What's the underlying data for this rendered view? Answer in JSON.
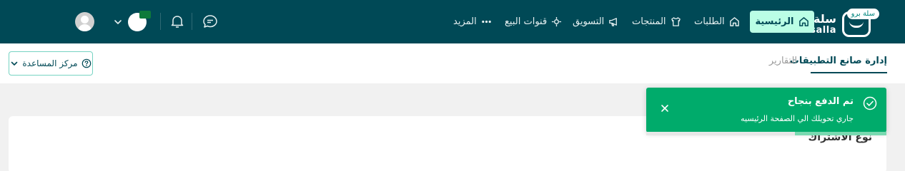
{
  "brand": {
    "name_ar": "سلة",
    "name_en": "salla",
    "badge": "سلة برو"
  },
  "nav": {
    "home": "الرئيسية",
    "orders": "الطلبات",
    "products": "المنتجات",
    "marketing": "التسويق",
    "channels": "قنوات البيع",
    "more": "المزيد"
  },
  "tabs": {
    "active": "إدارة صانع التطبيقات",
    "reports": "التقارير"
  },
  "help": {
    "label": "مركز المساعدة"
  },
  "card": {
    "title": "نوع الاشتراك"
  },
  "toast": {
    "title": "تم الدفع بنجاح",
    "message": "جاري تحويلك الي الصفحة الرئيسيه",
    "progress": 0.38
  },
  "colors": {
    "navbar": "#004956",
    "accent": "#bafee5",
    "success": "#00ab6b"
  },
  "icons": [
    "logo-icon",
    "home-icon",
    "orders-icon",
    "products-icon",
    "marketing-icon",
    "channels-icon",
    "more-icon",
    "chat-icon",
    "bell-icon",
    "store-avatar",
    "chevron-down-icon",
    "user-avatar",
    "help-icon",
    "check-circle-icon",
    "close-icon"
  ]
}
